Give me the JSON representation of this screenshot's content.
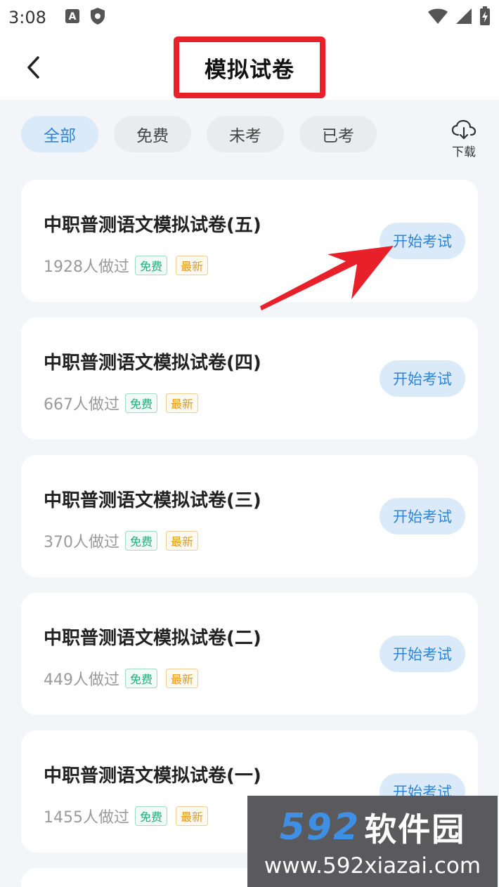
{
  "status_bar": {
    "time": "3:08"
  },
  "header": {
    "title": "模拟试卷"
  },
  "filters": {
    "tabs": [
      {
        "label": "全部",
        "active": true
      },
      {
        "label": "免费",
        "active": false
      },
      {
        "label": "未考",
        "active": false
      },
      {
        "label": "已考",
        "active": false
      }
    ],
    "download_label": "下载"
  },
  "papers": [
    {
      "title": "中职普测语文模拟试卷(五)",
      "done_count": "1928人做过",
      "tag_free": "免费",
      "tag_new": "最新",
      "action": "开始考试"
    },
    {
      "title": "中职普测语文模拟试卷(四)",
      "done_count": "667人做过",
      "tag_free": "免费",
      "tag_new": "最新",
      "action": "开始考试"
    },
    {
      "title": "中职普测语文模拟试卷(三)",
      "done_count": "370人做过",
      "tag_free": "免费",
      "tag_new": "最新",
      "action": "开始考试"
    },
    {
      "title": "中职普测语文模拟试卷(二)",
      "done_count": "449人做过",
      "tag_free": "免费",
      "tag_new": "最新",
      "action": "开始考试"
    },
    {
      "title": "中职普测语文模拟试卷(一)",
      "done_count": "1455人做过",
      "tag_free": "免费",
      "tag_new": "最新",
      "action": "开始考试"
    }
  ],
  "watermark": {
    "number": "592",
    "name": "软件园",
    "url": "www.592xiazai.com"
  },
  "colors": {
    "accent": "#2f84d6",
    "accent_bg": "#dbeaf8",
    "highlight_red": "#e8202a",
    "tag_free": "#1fae7a",
    "tag_new": "#e59a1c"
  }
}
